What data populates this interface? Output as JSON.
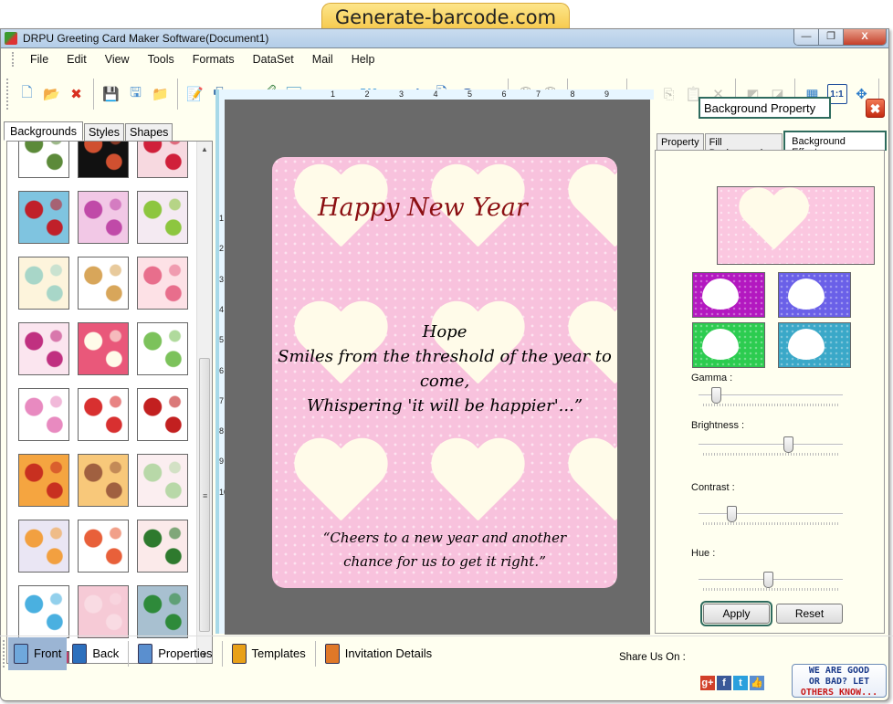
{
  "banner": "Generate-barcode.com",
  "window": {
    "title": "DRPU Greeting Card Maker Software(Document1)",
    "controls": {
      "minimize": "—",
      "restore": "❐",
      "close": "X"
    }
  },
  "menu": [
    "File",
    "Edit",
    "View",
    "Tools",
    "Formats",
    "DataSet",
    "Mail",
    "Help"
  ],
  "toolbar": [
    {
      "name": "new-icon",
      "glyph": "🗋",
      "enabled": true
    },
    {
      "name": "open-icon",
      "glyph": "📂",
      "enabled": true
    },
    {
      "name": "close-document-icon",
      "glyph": "✖",
      "enabled": true
    },
    {
      "sep": true
    },
    {
      "name": "save-icon",
      "glyph": "💾",
      "enabled": true
    },
    {
      "name": "save-as-icon",
      "glyph": "🖫",
      "enabled": true
    },
    {
      "name": "export-icon",
      "glyph": "📁",
      "enabled": true
    },
    {
      "sep": true
    },
    {
      "name": "properties-icon",
      "glyph": "📝",
      "enabled": true
    },
    {
      "name": "print-icon",
      "glyph": "🖶",
      "enabled": true
    },
    {
      "name": "background-icon",
      "glyph": "▦",
      "enabled": true
    },
    {
      "name": "card-design-icon",
      "glyph": "🖉",
      "enabled": true
    },
    {
      "name": "insert-image-icon",
      "glyph": "🖼",
      "enabled": true
    },
    {
      "name": "pen-icon",
      "glyph": "✒",
      "enabled": true
    },
    {
      "name": "shapes-icon",
      "glyph": "△",
      "enabled": true
    },
    {
      "name": "word-art-icon",
      "glyph": "W",
      "enabled": true
    },
    {
      "name": "barcode-icon",
      "glyph": "▥",
      "enabled": true
    },
    {
      "name": "text-icon",
      "glyph": "A",
      "enabled": true
    },
    {
      "name": "text-file-icon",
      "glyph": "🗎",
      "enabled": true
    },
    {
      "name": "signature-icon",
      "glyph": "S",
      "enabled": true
    },
    {
      "name": "mail-icon",
      "glyph": "✉",
      "enabled": true
    },
    {
      "sep": true
    },
    {
      "name": "database-add-icon",
      "glyph": "🛢",
      "enabled": true
    },
    {
      "name": "database-icon",
      "glyph": "🛢",
      "enabled": true
    },
    {
      "sep": true
    },
    {
      "name": "undo-icon",
      "glyph": "↶",
      "enabled": true
    },
    {
      "name": "redo-icon",
      "glyph": "↷",
      "enabled": false
    },
    {
      "sep": true
    },
    {
      "name": "cut-icon",
      "glyph": "✂",
      "enabled": false
    },
    {
      "name": "copy-icon",
      "glyph": "⎘",
      "enabled": false
    },
    {
      "name": "paste-icon",
      "glyph": "📋",
      "enabled": false
    },
    {
      "name": "delete-icon",
      "glyph": "✕",
      "enabled": false
    },
    {
      "sep": true
    },
    {
      "name": "bring-front-icon",
      "glyph": "◩",
      "enabled": false
    },
    {
      "name": "send-back-icon",
      "glyph": "◪",
      "enabled": false
    },
    {
      "sep": true
    },
    {
      "name": "grid-icon",
      "glyph": "▦",
      "enabled": true
    },
    {
      "name": "actual-size-icon",
      "glyph": "1:1",
      "enabled": true
    },
    {
      "name": "fit-window-icon",
      "glyph": "✥",
      "enabled": true
    },
    {
      "sep": true
    }
  ],
  "left_panel": {
    "tabs": [
      "Backgrounds",
      "Styles",
      "Shapes"
    ],
    "active_tab": "Backgrounds",
    "thumbnails": [
      {
        "name": "green-leaves",
        "colors": [
          "#ffffff",
          "#5c8a3a"
        ]
      },
      {
        "name": "fireworks",
        "colors": [
          "#111111",
          "#d05030"
        ]
      },
      {
        "name": "red-hearts",
        "colors": [
          "#f7d9e0",
          "#d0203a"
        ]
      },
      {
        "name": "santa-gifts",
        "colors": [
          "#7fc4e0",
          "#c0202a"
        ]
      },
      {
        "name": "pink-bubbles",
        "colors": [
          "#f2c8e6",
          "#c04aa8"
        ]
      },
      {
        "name": "pink-lilies",
        "colors": [
          "#f4eaf2",
          "#8dc63f"
        ]
      },
      {
        "name": "pastel-stripes",
        "colors": [
          "#fdf4dc",
          "#a8d6c8"
        ]
      },
      {
        "name": "teddy-bear",
        "colors": [
          "#ffffff",
          "#d8a65a"
        ]
      },
      {
        "name": "pink-dress",
        "colors": [
          "#fde1e6",
          "#e86e8c"
        ]
      },
      {
        "name": "hearts-butterflies",
        "colors": [
          "#fbe5ef",
          "#c03080"
        ]
      },
      {
        "name": "heart-bears",
        "colors": [
          "#e9587a",
          "#fffbe9"
        ]
      },
      {
        "name": "bunnies",
        "colors": [
          "#ffffff",
          "#7cc25b"
        ]
      },
      {
        "name": "kids-rainbows",
        "colors": [
          "#ffffff",
          "#e88ac0"
        ]
      },
      {
        "name": "white-hearts-bows",
        "colors": [
          "#ffffff",
          "#d83030"
        ]
      },
      {
        "name": "red-flower",
        "colors": [
          "#ffffff",
          "#c22020"
        ]
      },
      {
        "name": "autumn-butterflies",
        "colors": [
          "#f5a540",
          "#c83020"
        ]
      },
      {
        "name": "baby-bear-card",
        "colors": [
          "#f8c87a",
          "#a06040"
        ]
      },
      {
        "name": "floral-lace",
        "colors": [
          "#fbeef0",
          "#b8d8a8"
        ]
      },
      {
        "name": "daisies",
        "colors": [
          "#eae6f4",
          "#f2a040"
        ]
      },
      {
        "name": "party-gifts",
        "colors": [
          "#ffffff",
          "#e8603a"
        ]
      },
      {
        "name": "cherries",
        "colors": [
          "#fbeaea",
          "#2e7a2e"
        ]
      },
      {
        "name": "stars",
        "colors": [
          "#ffffff",
          "#4ab0e0"
        ]
      },
      {
        "name": "pink-texture",
        "colors": [
          "#f6cad6",
          "#f9dbe3"
        ]
      },
      {
        "name": "christmas-snowmen",
        "colors": [
          "#a8c0d0",
          "#2e8a3a"
        ]
      },
      {
        "name": "vintage-stripes",
        "colors": [
          "#c0406a",
          "#e8a060"
        ]
      }
    ]
  },
  "ruler": {
    "horizontal": [
      "1",
      "2",
      "3",
      "4",
      "5",
      "6",
      "7",
      "8",
      "9"
    ],
    "vertical": [
      "1",
      "2",
      "3",
      "4",
      "5",
      "6",
      "7",
      "8",
      "9",
      "10"
    ]
  },
  "card": {
    "title": "Happy New Year",
    "poem": [
      "Hope",
      "Smiles from the threshold of the year to",
      "come,",
      "Whispering 'it will be happier'...”"
    ],
    "quote": [
      "“Cheers to a new year and another",
      "chance for us to get it right.”"
    ],
    "colors": {
      "background": "#f8c2dd",
      "title": "#8b0f12"
    }
  },
  "right_panel": {
    "title": "Background Property",
    "close_icon": "✖",
    "tabs": [
      "Property",
      "Fill Background",
      "Background Effects"
    ],
    "active_tab": "Background Effects",
    "effect_presets": [
      {
        "name": "magenta",
        "color": "#b318c0"
      },
      {
        "name": "violet",
        "color": "#6a60e8"
      },
      {
        "name": "green",
        "color": "#2ccc50"
      },
      {
        "name": "teal",
        "color": "#3aa8c8"
      }
    ],
    "sliders": [
      {
        "label": "Gamma :",
        "value": 0.12
      },
      {
        "label": "Brightness :",
        "value": 0.62
      },
      {
        "label": "Contrast :",
        "value": 0.23
      },
      {
        "label": "Hue :",
        "value": 0.48
      }
    ],
    "apply_label": "Apply",
    "reset_label": "Reset"
  },
  "bottom_bar": {
    "items": [
      {
        "label": "Front",
        "active": true,
        "color": "#6fa8dc"
      },
      {
        "label": "Back",
        "active": false,
        "color": "#2c6fbd"
      },
      {
        "label": "Properties",
        "active": false,
        "color": "#5a8fcf"
      },
      {
        "label": "Templates",
        "active": false,
        "color": "#e8a018"
      },
      {
        "label": "Invitation Details",
        "active": false,
        "color": "#e07828"
      }
    ],
    "share_label": "Share Us On :",
    "social": [
      {
        "name": "google-plus-icon",
        "glyph": "g+",
        "color": "#d2402a"
      },
      {
        "name": "facebook-icon",
        "glyph": "f",
        "color": "#3b5998"
      },
      {
        "name": "twitter-icon",
        "glyph": "t",
        "color": "#2ba0dd"
      },
      {
        "name": "like-icon",
        "glyph": "👍",
        "color": "#5b8fd0"
      }
    ],
    "rate_lines": [
      "WE ARE GOOD",
      "OR BAD? LET",
      "OTHERS KNOW..."
    ]
  }
}
